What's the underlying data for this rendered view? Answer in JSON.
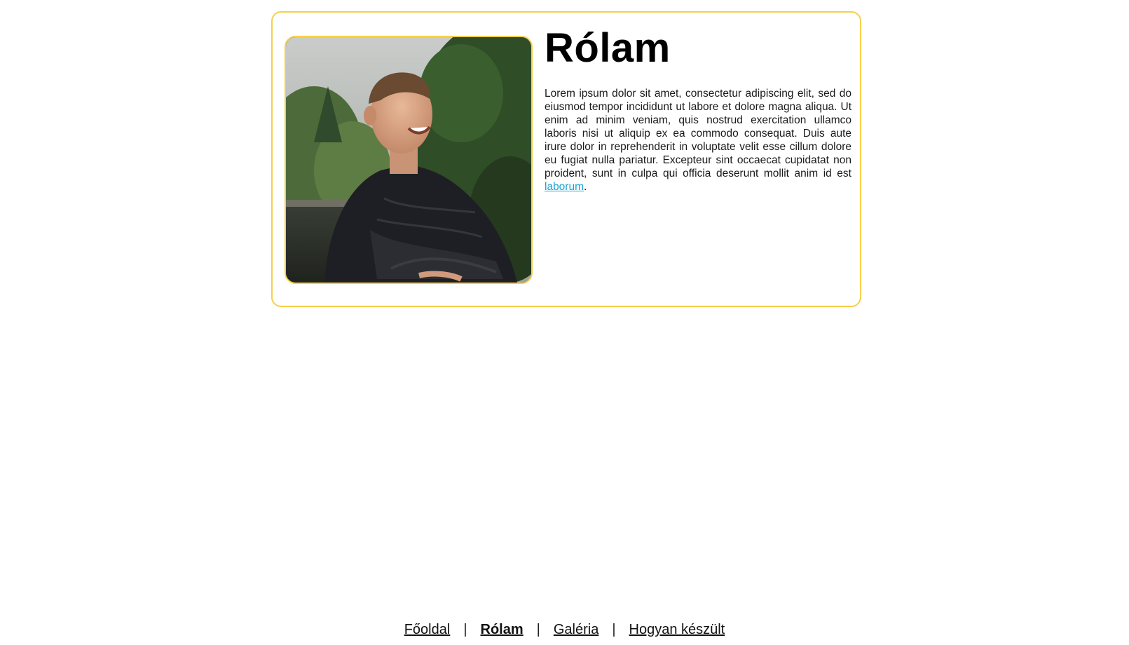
{
  "about": {
    "title": "Rólam",
    "paragraph": "Lorem ipsum dolor sit amet, consectetur adipiscing elit, sed do eiusmod tempor incididunt ut labore et dolore magna aliqua. Ut enim ad minim veniam, quis nostrud exercitation ullamco laboris nisi ut aliquip ex ea commodo consequat. Duis aute irure dolor in reprehenderit in voluptate velit esse cillum dolore eu fugiat nulla pariatur. Excepteur sint occaecat cupidatat non proident, sunt in culpa qui officia deserunt mollit anim id est",
    "link_text": "laborum",
    "trailing": "."
  },
  "nav": {
    "items": [
      {
        "label": "Főoldal",
        "active": false
      },
      {
        "label": "Rólam",
        "active": true
      },
      {
        "label": "Galéria",
        "active": false
      },
      {
        "label": "Hogyan készült",
        "active": false
      }
    ],
    "separator": "|"
  },
  "colors": {
    "accent_border": "#f7cf4a",
    "link": "#1aa3d6",
    "background": "#ffffff",
    "text": "#111111"
  }
}
